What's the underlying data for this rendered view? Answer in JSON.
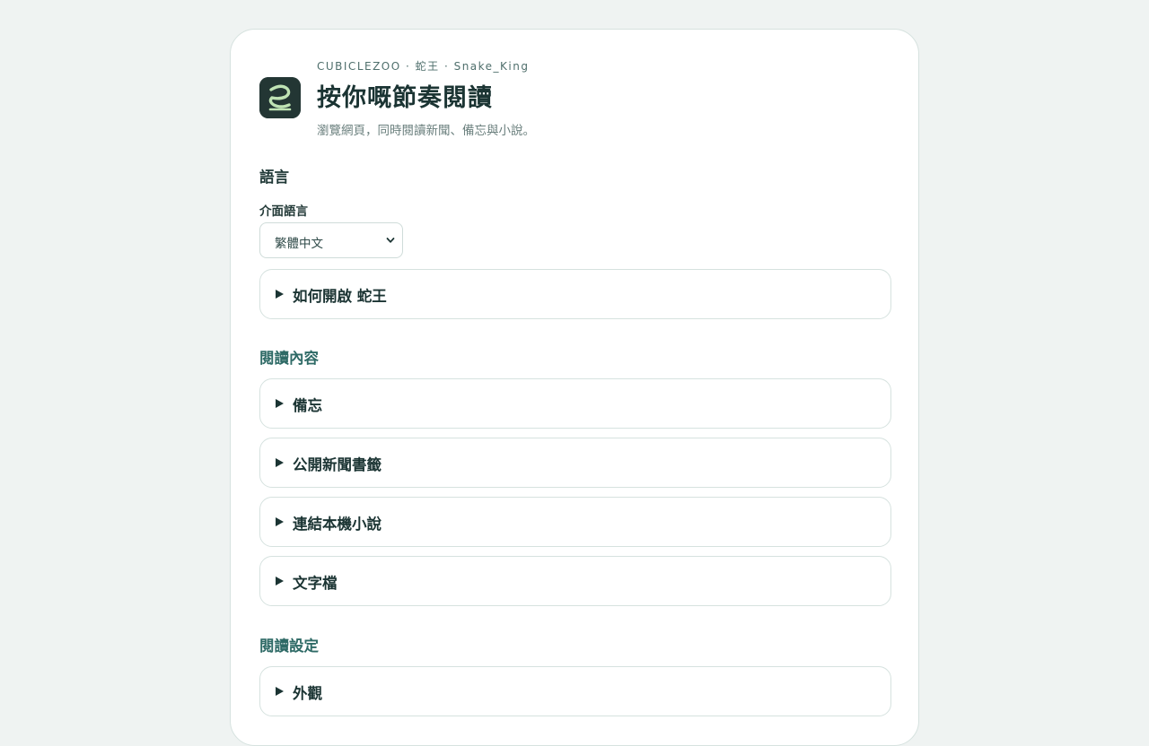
{
  "header": {
    "eyebrow": "CUBICLEZOO · 蛇王 · Snake_King",
    "title": "按你嘅節奏閱讀",
    "subtitle": "瀏覽網頁，同時閱讀新聞、備忘與小說。",
    "logo_icon": "snake-logo-icon"
  },
  "language": {
    "section_title": "語言",
    "field_label": "介面語言",
    "selected_value": "繁體中文",
    "how_to_open": "如何開啟 蛇王"
  },
  "reading_content": {
    "section_title": "閱讀內容",
    "items": [
      {
        "label": "備忘"
      },
      {
        "label": "公開新聞書籤"
      },
      {
        "label": "連結本機小說"
      },
      {
        "label": "文字檔"
      }
    ]
  },
  "reading_settings": {
    "section_title": "閱讀設定",
    "items": [
      {
        "label": "外觀"
      }
    ]
  },
  "colors": {
    "page_background": "#eff3f2",
    "card_background": "#ffffff",
    "border": "#d6e2df",
    "title_text": "#1b3433",
    "teal_accent": "#2e6a66",
    "logo_background": "#233634",
    "logo_glyph": "#bfe3b4"
  }
}
